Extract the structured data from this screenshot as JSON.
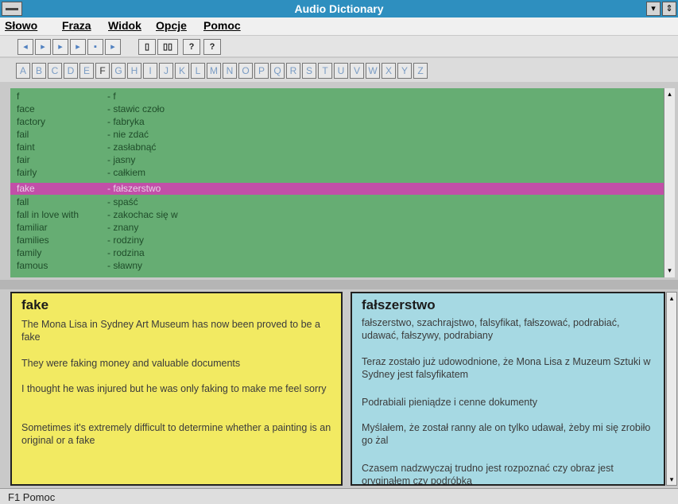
{
  "window": {
    "title": "Audio Dictionary",
    "minimize_label": "▾",
    "restore_label": "⇕"
  },
  "menu": [
    "Słowo",
    "Fraza",
    "Widok",
    "Opcje",
    "Pomoc"
  ],
  "toolbar": {
    "buttons": [
      "◂",
      "▸",
      "▸",
      "▸",
      "▪",
      "▸",
      "▯",
      "▯▯",
      "?",
      "?"
    ]
  },
  "letters": [
    "A",
    "B",
    "C",
    "D",
    "E",
    "F",
    "G",
    "H",
    "I",
    "J",
    "K",
    "L",
    "M",
    "N",
    "O",
    "P",
    "Q",
    "R",
    "S",
    "T",
    "U",
    "V",
    "W",
    "X",
    "Y",
    "Z"
  ],
  "word_list": [
    {
      "word": "f",
      "translation": "- f"
    },
    {
      "word": "face",
      "translation": "- stawic czoło"
    },
    {
      "word": "factory",
      "translation": "- fabryka"
    },
    {
      "word": "fail",
      "translation": "- nie zdać"
    },
    {
      "word": "faint",
      "translation": "- zasłabnąć"
    },
    {
      "word": "fair",
      "translation": "- jasny"
    },
    {
      "word": "fairly",
      "translation": "- całkiem"
    },
    {
      "word": "fake",
      "translation": "- fałszerstwo",
      "selected": true
    },
    {
      "word": "fall",
      "translation": "- spaść"
    },
    {
      "word": "fall in love with",
      "translation": "- zakochac się w"
    },
    {
      "word": "familiar",
      "translation": "- znany"
    },
    {
      "word": "families",
      "translation": "- rodziny"
    },
    {
      "word": "family",
      "translation": "- rodzina"
    },
    {
      "word": "famous",
      "translation": "- sławny"
    }
  ],
  "scroll": {
    "up": "▴",
    "down": "▾"
  },
  "english_card": {
    "headword": "fake",
    "examples": [
      "The Mona Lisa in Sydney Art Museum has now been proved to be a fake",
      "They were faking money and valuable documents",
      "I thought he was injured but he was only faking to make me feel sorry",
      "Sometimes it's extremely difficult to determine whether a painting is an original or a fake"
    ]
  },
  "polish_card": {
    "headword": "fałszerstwo",
    "synonyms": "fałszerstwo, szachrajstwo, falsyfikat, fałszować, podrabiać, udawać, fałszywy, podrabiany",
    "examples": [
      "Teraz zostało już udowodnione, że Mona Lisa z Muzeum Sztuki w Sydney jest falsyfikatem",
      "Podrabiali pieniądze i cenne dokumenty",
      "Myślałem, że został ranny ale on tylko udawał, żeby mi się zrobiło go żal",
      "Czasem nadzwyczaj trudno jest rozpoznać czy obraz jest oryginałem czy podróbką"
    ]
  },
  "status": {
    "text": "F1 Pomoc"
  },
  "colors": {
    "title_bar": "#2e8fbf",
    "list_bg": "#66ad73",
    "selection": "#c24fa8",
    "english_card": "#f2ea62",
    "polish_card": "#a6d9e3"
  }
}
